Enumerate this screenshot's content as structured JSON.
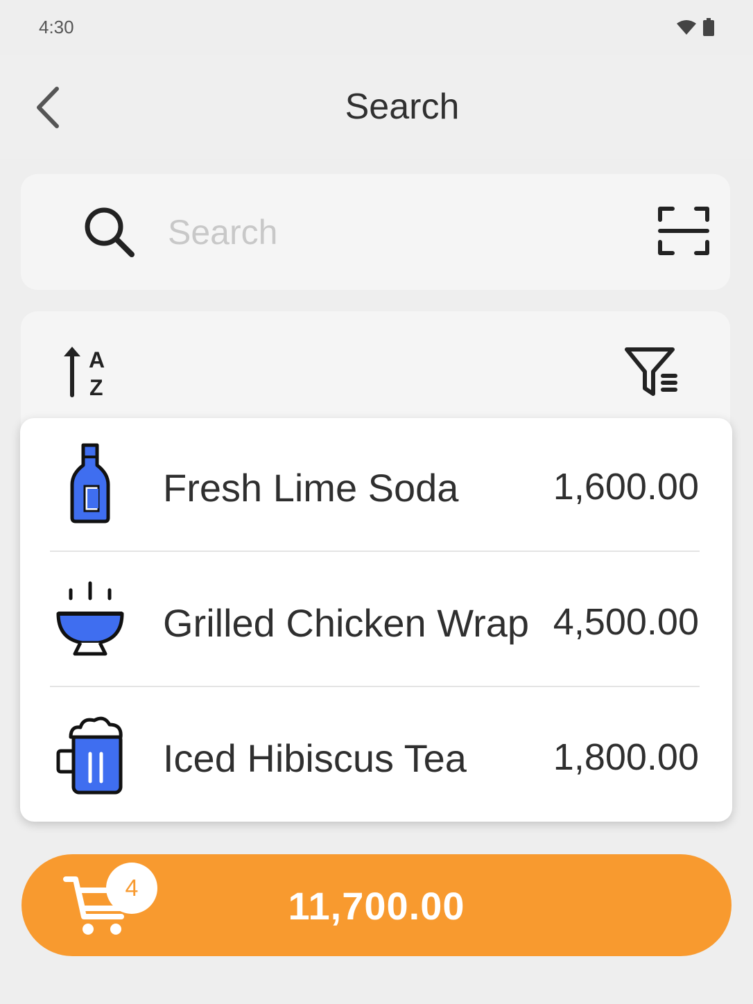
{
  "status_bar": {
    "time": "4:30",
    "icons": [
      "wifi-icon",
      "battery-icon"
    ]
  },
  "app_bar": {
    "title": "Search",
    "back_icon": "chevron-left-icon"
  },
  "search": {
    "placeholder": "Search",
    "value": "",
    "icon": "search-icon",
    "scan_icon": "barcode-scan-icon"
  },
  "toolbar": {
    "sort_icon": "sort-a-z-icon",
    "filter_icon": "filter-list-icon"
  },
  "results": [
    {
      "icon": "bottle-icon",
      "name": "Fresh Lime Soda",
      "price": "1,600.00"
    },
    {
      "icon": "bowl-icon",
      "name": "Grilled Chicken Wrap",
      "price": "4,500.00"
    },
    {
      "icon": "mug-icon",
      "name": "Iced Hibiscus Tea",
      "price": "1,800.00"
    }
  ],
  "cart": {
    "icon": "cart-icon",
    "count": "4",
    "total": "11,700.00"
  },
  "colors": {
    "accent": "#f89a2f",
    "item_icon_blue": "#3f6ef0",
    "background": "#eeeeee",
    "card": "#ffffff"
  }
}
